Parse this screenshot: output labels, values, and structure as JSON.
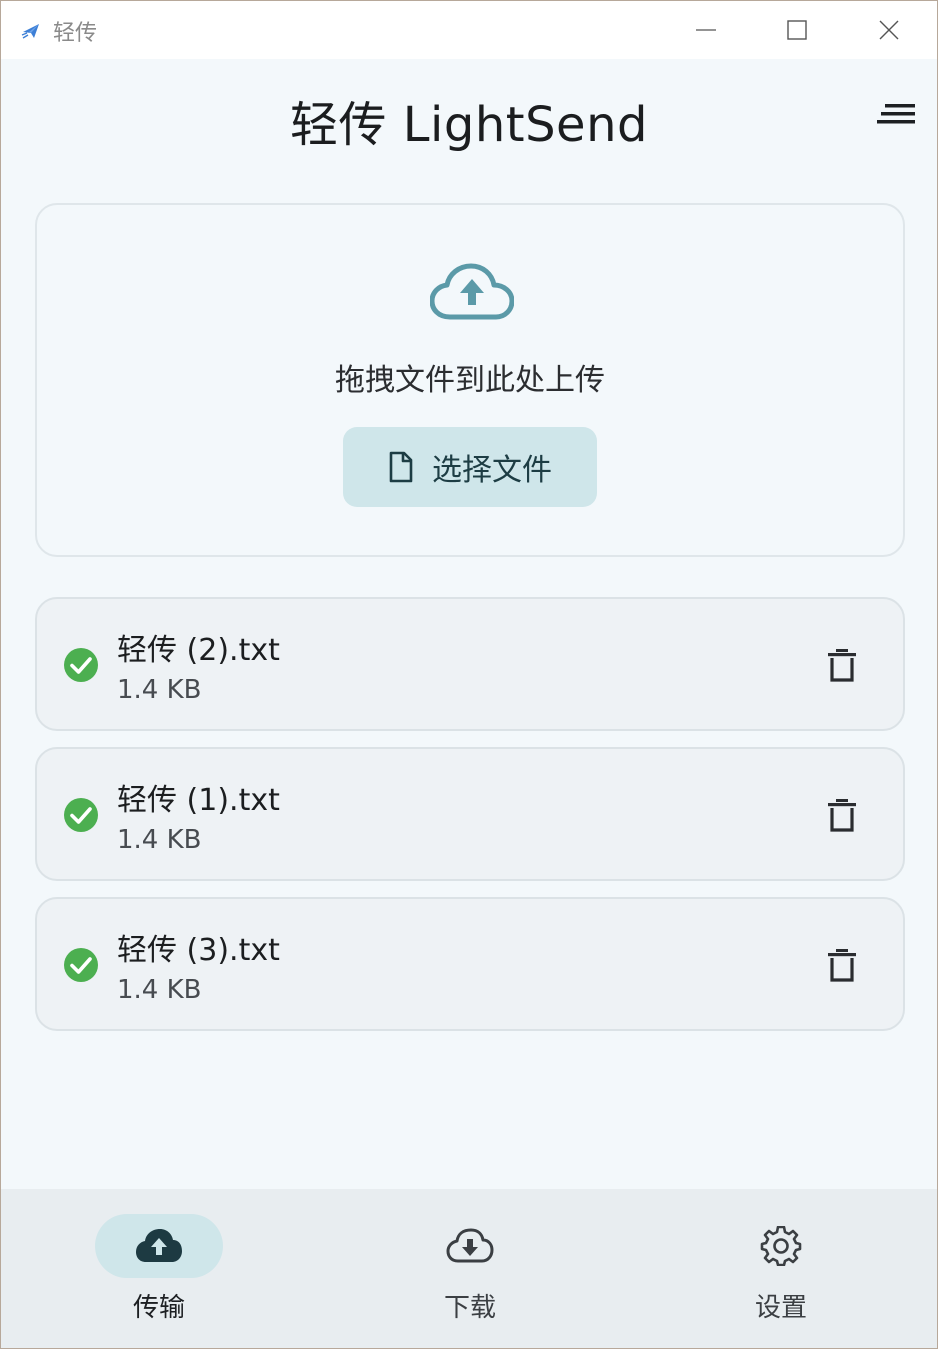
{
  "window": {
    "title": "轻传"
  },
  "header": {
    "title": "轻传 LightSend"
  },
  "dropzone": {
    "prompt": "拖拽文件到此处上传",
    "choose_button_label": "选择文件"
  },
  "files": [
    {
      "name": "轻传 (2).txt",
      "size": "1.4 KB",
      "status": "uploaded"
    },
    {
      "name": "轻传 (1).txt",
      "size": "1.4 KB",
      "status": "uploaded"
    },
    {
      "name": "轻传 (3).txt",
      "size": "1.4 KB",
      "status": "uploaded"
    }
  ],
  "bottom_nav": {
    "items": [
      {
        "label": "传输",
        "icon": "cloud-upload-icon",
        "active": true
      },
      {
        "label": "下载",
        "icon": "cloud-download-icon",
        "active": false
      },
      {
        "label": "设置",
        "icon": "gear-icon",
        "active": false
      }
    ]
  },
  "colors": {
    "accent": "#5b9aa8",
    "accent_container": "#cfe6ea",
    "success": "#4caf50",
    "background": "#f3f8fb"
  }
}
